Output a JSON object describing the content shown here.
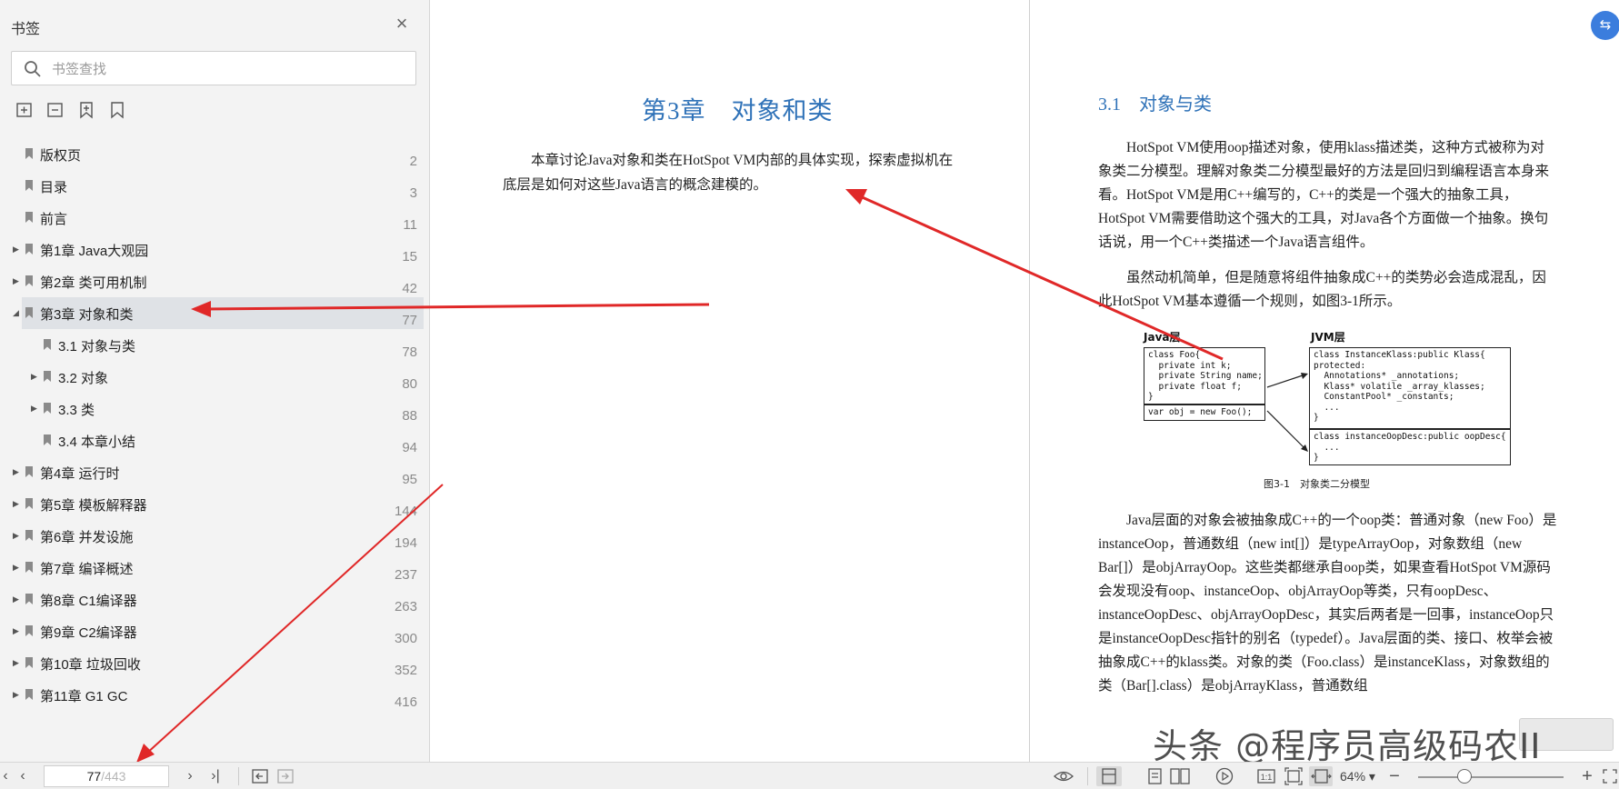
{
  "sidebar": {
    "title": "书签",
    "search_placeholder": "书签查找",
    "items": [
      {
        "label": "版权页",
        "page": "2"
      },
      {
        "label": "目录",
        "page": "3"
      },
      {
        "label": "前言",
        "page": "11"
      },
      {
        "label": "第1章 Java大观园",
        "page": "15"
      },
      {
        "label": "第2章 类可用机制",
        "page": "42"
      },
      {
        "label": "第3章 对象和类",
        "page": "77"
      },
      {
        "label": "3.1 对象与类",
        "page": "78"
      },
      {
        "label": "3.2 对象",
        "page": "80"
      },
      {
        "label": "3.3 类",
        "page": "88"
      },
      {
        "label": "3.4 本章小结",
        "page": "94"
      },
      {
        "label": "第4章 运行时",
        "page": "95"
      },
      {
        "label": "第5章 模板解释器",
        "page": "144"
      },
      {
        "label": "第6章 并发设施",
        "page": "194"
      },
      {
        "label": "第7章 编译概述",
        "page": "237"
      },
      {
        "label": "第8章 C1编译器",
        "page": "263"
      },
      {
        "label": "第9章 C2编译器",
        "page": "300"
      },
      {
        "label": "第10章 垃圾回收",
        "page": "352"
      },
      {
        "label": "第11章 G1 GC",
        "page": "416"
      }
    ],
    "selected_index": 5,
    "icons": [
      "bookmark-icon",
      "close-icon",
      "search-icon",
      "add-bookmark-icon",
      "remove-bookmark-icon",
      "mark-bookmark-icon",
      "bookmark-outline-icon"
    ]
  },
  "left_page": {
    "chapter_title": "第3章　对象和类",
    "intro": "本章讨论Java对象和类在HotSpot VM内部的具体实现，探索虚拟机在底层是如何对这些Java语言的概念建模的。"
  },
  "right_page": {
    "section_title": "3.1　对象与类",
    "para1": "HotSpot VM使用oop描述对象，使用klass描述类，这种方式被称为对象类二分模型。理解对象类二分模型最好的方法是回归到编程语言本身来看。HotSpot VM是用C++编写的，C++的类是一个强大的抽象工具，HotSpot VM需要借助这个强大的工具，对Java各个方面做一个抽象。换句话说，用一个C++类描述一个Java语言组件。",
    "para2": "虽然动机简单，但是随意将组件抽象成C++的类势必会造成混乱，因此HotSpot VM基本遵循一个规则，如图3-1所示。",
    "para3": "Java层面的对象会被抽象成C++的一个oop类：普通对象（new Foo）是instanceOop，普通数组（new int[]）是typeArrayOop，对象数组（new Bar[]）是objArrayOop。这些类都继承自oop类，如果查看HotSpot VM源码会发现没有oop、instanceOop、objArrayOop等类，只有oopDesc、instanceOopDesc、objArrayOopDesc，其实后两者是一回事，instanceOop只是instanceOopDesc指针的别名（typedef）。Java层面的类、接口、枚举会被抽象成C++的klass类。对象的类（Foo.class）是instanceKlass，对象数组的类（Bar[].class）是objArrayKlass，普通数组",
    "figure": {
      "java_head": "Java层",
      "jvm_head": "JVM层",
      "foo_code": "class Foo{\n  private int k;\n  private String name;\n  private float f;\n}",
      "var_code": "var obj = new Foo();",
      "klass_code": "class InstanceKlass:public Klass{\nprotected:\n  Annotations* _annotations;\n  Klass* volatile _array_klasses;\n  ConstantPool* _constants;\n  ...\n}",
      "oop_code": "class instanceOopDesc:public oopDesc{\n  ...\n}",
      "caption": "图3-1　对象类二分模型"
    }
  },
  "statusbar": {
    "page_current": "77",
    "page_total": "/443",
    "zoom": "64%",
    "icons": [
      "first-page-icon",
      "prev-page-icon",
      "next-page-icon",
      "last-page-icon",
      "back-icon",
      "forward-icon",
      "eye-icon",
      "single-page-icon",
      "continuous-page-icon",
      "dual-page-icon",
      "play-icon",
      "actual-size-icon",
      "fit-page-icon",
      "fit-width-icon",
      "zoom-out-icon",
      "zoom-in-icon",
      "fullscreen-icon"
    ]
  },
  "watermark": "头条 @程序员高级码农II",
  "colors": {
    "accent": "#2f72b8",
    "arrow": "#e02828",
    "sidebar_bg": "#f3f3f3",
    "selected_bg": "#dfe2e6"
  }
}
